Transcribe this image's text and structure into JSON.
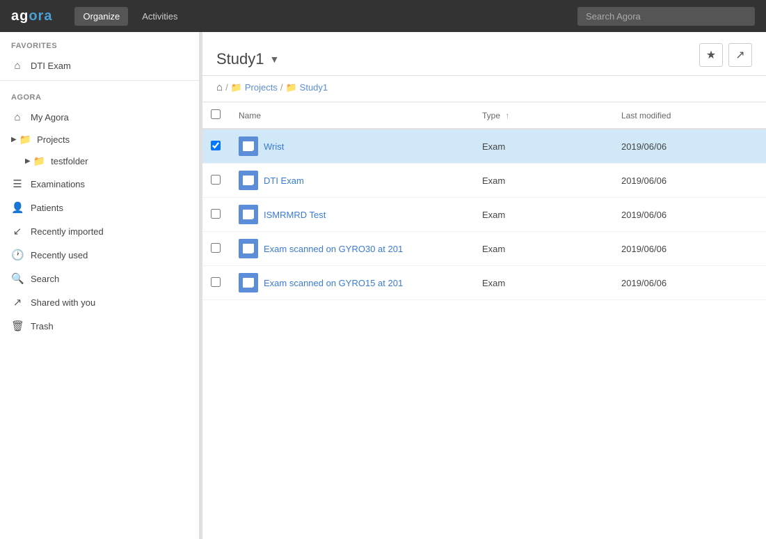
{
  "navbar": {
    "logo_ag": "ag",
    "logo_ora": "ora",
    "nav_items": [
      {
        "label": "Organize",
        "active": true
      },
      {
        "label": "Activities",
        "active": false
      }
    ],
    "search_placeholder": "Search Agora"
  },
  "sidebar": {
    "favorites_label": "FAVORITES",
    "favorites_items": [
      {
        "label": "DTI Exam",
        "icon": "home"
      }
    ],
    "agora_label": "AGORA",
    "agora_items": [
      {
        "label": "My Agora",
        "icon": "home",
        "type": "home"
      },
      {
        "label": "Projects",
        "icon": "folder",
        "type": "tree",
        "expanded": true
      },
      {
        "label": "testfolder",
        "icon": "folder",
        "type": "subtree"
      },
      {
        "label": "Examinations",
        "icon": "list",
        "type": "item"
      },
      {
        "label": "Patients",
        "icon": "person",
        "type": "item"
      },
      {
        "label": "Recently imported",
        "icon": "clock-import",
        "type": "item"
      },
      {
        "label": "Recently used",
        "icon": "clock",
        "type": "item"
      },
      {
        "label": "Search",
        "icon": "search",
        "type": "item"
      },
      {
        "label": "Shared with you",
        "icon": "share",
        "type": "item"
      },
      {
        "label": "Trash",
        "icon": "trash",
        "type": "item"
      }
    ]
  },
  "content": {
    "title": "Study1",
    "breadcrumb": {
      "home_label": "home",
      "items": [
        {
          "label": "Projects",
          "icon": "folder"
        },
        {
          "label": "Study1",
          "icon": "folder"
        }
      ]
    },
    "table": {
      "columns": [
        {
          "label": "Name",
          "sortable": true
        },
        {
          "label": "Type",
          "sortable": true,
          "sort_dir": "asc"
        },
        {
          "label": "Last modified",
          "sortable": false
        }
      ],
      "rows": [
        {
          "name": "Wrist",
          "type": "Exam",
          "modified": "2019/06/06",
          "selected": true
        },
        {
          "name": "DTI Exam",
          "type": "Exam",
          "modified": "2019/06/06",
          "selected": false
        },
        {
          "name": "ISMRMRD Test",
          "type": "Exam",
          "modified": "2019/06/06",
          "selected": false
        },
        {
          "name": "Exam scanned on GYRO30 at 201",
          "type": "Exam",
          "modified": "2019/06/06",
          "selected": false
        },
        {
          "name": "Exam scanned on GYRO15 at 201",
          "type": "Exam",
          "modified": "2019/06/06",
          "selected": false
        }
      ]
    }
  }
}
